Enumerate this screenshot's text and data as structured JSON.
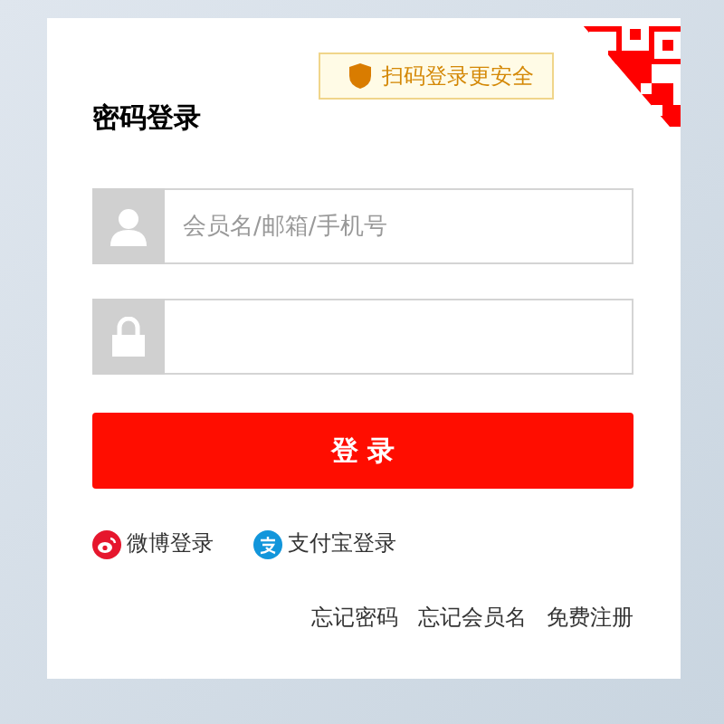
{
  "qr_tip": {
    "text": "扫码登录更安全"
  },
  "title": "密码登录",
  "fields": [
    {
      "kind": "user",
      "placeholder": "会员名/邮箱/手机号"
    },
    {
      "kind": "password"
    }
  ],
  "submit": "登 录",
  "social": [
    {
      "kind": "weibo",
      "label": "微博登录"
    },
    {
      "kind": "alipay",
      "label": "支付宝登录"
    }
  ],
  "links": [
    "忘记密码",
    "忘记会员名",
    "免费注册"
  ]
}
